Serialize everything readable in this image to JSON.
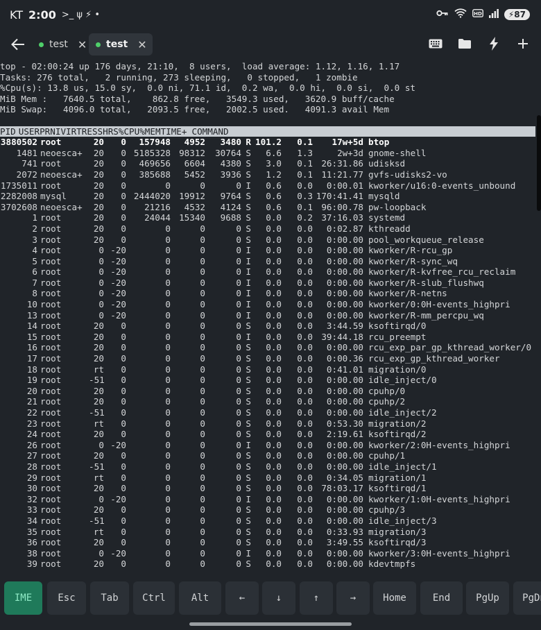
{
  "status_bar": {
    "carrier": "KT",
    "time": "2:00",
    "symbols": ">_  ψ  ⚡  •",
    "battery": "87"
  },
  "tabs": [
    {
      "label": "test",
      "active": false
    },
    {
      "label": "test",
      "active": true
    }
  ],
  "colors": {
    "background": "#202429",
    "tab_dot": "#4fcf6a",
    "ime_key": "#1f7a5a",
    "header_bg": "#c8cdd2"
  },
  "top_summary": [
    "top - 02:00:24 up 176 days, 21:10,  8 users,  load average: 1.12, 1.16, 1.17",
    "Tasks: 276 total,   2 running, 273 sleeping,   0 stopped,   1 zombie",
    "%Cpu(s): 13.8 us, 15.0 sy,  0.0 ni, 71.1 id,  0.2 wa,  0.0 hi,  0.0 si,  0.0 st",
    "MiB Mem :   7640.5 total,    862.8 free,   3549.3 used,   3620.9 buff/cache",
    "MiB Swap:   4096.0 total,   2093.5 free,   2002.5 used.   4091.3 avail Mem"
  ],
  "columns": [
    "PID",
    "USER",
    "PR",
    "NI",
    "VIRT",
    "RES",
    "SHR",
    "S",
    "%CPU",
    "%MEM",
    "TIME+",
    "COMMAND"
  ],
  "processes": [
    [
      "3880502",
      "root",
      "20",
      "0",
      "157948",
      "4952",
      "3480",
      "R",
      "101.2",
      "0.1",
      "17w+5d",
      "btop"
    ],
    [
      "1481",
      "neoesca+",
      "20",
      "0",
      "5185328",
      "98312",
      "30764",
      "S",
      "6.6",
      "1.3",
      "2w+3d",
      "gnome-shell"
    ],
    [
      "741",
      "root",
      "20",
      "0",
      "469656",
      "6604",
      "4380",
      "S",
      "3.0",
      "0.1",
      "26:31.86",
      "udisksd"
    ],
    [
      "2072",
      "neoesca+",
      "20",
      "0",
      "385688",
      "5452",
      "3936",
      "S",
      "1.2",
      "0.1",
      "11:21.77",
      "gvfs-udisks2-vo"
    ],
    [
      "1735011",
      "root",
      "20",
      "0",
      "0",
      "0",
      "0",
      "I",
      "0.6",
      "0.0",
      "0:00.01",
      "kworker/u16:0-events_unbound"
    ],
    [
      "2282008",
      "mysql",
      "20",
      "0",
      "2444020",
      "19912",
      "9764",
      "S",
      "0.6",
      "0.3",
      "170:41.41",
      "mysqld"
    ],
    [
      "3702608",
      "neoesca+",
      "20",
      "0",
      "21216",
      "4532",
      "4124",
      "S",
      "0.6",
      "0.1",
      "96:00.78",
      "pw-loopback"
    ],
    [
      "1",
      "root",
      "20",
      "0",
      "24044",
      "15340",
      "9688",
      "S",
      "0.0",
      "0.2",
      "37:16.03",
      "systemd"
    ],
    [
      "2",
      "root",
      "20",
      "0",
      "0",
      "0",
      "0",
      "S",
      "0.0",
      "0.0",
      "0:02.87",
      "kthreadd"
    ],
    [
      "3",
      "root",
      "20",
      "0",
      "0",
      "0",
      "0",
      "S",
      "0.0",
      "0.0",
      "0:00.00",
      "pool_workqueue_release"
    ],
    [
      "4",
      "root",
      "0",
      "-20",
      "0",
      "0",
      "0",
      "I",
      "0.0",
      "0.0",
      "0:00.00",
      "kworker/R-rcu_gp"
    ],
    [
      "5",
      "root",
      "0",
      "-20",
      "0",
      "0",
      "0",
      "I",
      "0.0",
      "0.0",
      "0:00.00",
      "kworker/R-sync_wq"
    ],
    [
      "6",
      "root",
      "0",
      "-20",
      "0",
      "0",
      "0",
      "I",
      "0.0",
      "0.0",
      "0:00.00",
      "kworker/R-kvfree_rcu_reclaim"
    ],
    [
      "7",
      "root",
      "0",
      "-20",
      "0",
      "0",
      "0",
      "I",
      "0.0",
      "0.0",
      "0:00.00",
      "kworker/R-slub_flushwq"
    ],
    [
      "8",
      "root",
      "0",
      "-20",
      "0",
      "0",
      "0",
      "I",
      "0.0",
      "0.0",
      "0:00.00",
      "kworker/R-netns"
    ],
    [
      "10",
      "root",
      "0",
      "-20",
      "0",
      "0",
      "0",
      "I",
      "0.0",
      "0.0",
      "0:00.00",
      "kworker/0:0H-events_highpri"
    ],
    [
      "13",
      "root",
      "0",
      "-20",
      "0",
      "0",
      "0",
      "I",
      "0.0",
      "0.0",
      "0:00.00",
      "kworker/R-mm_percpu_wq"
    ],
    [
      "14",
      "root",
      "20",
      "0",
      "0",
      "0",
      "0",
      "S",
      "0.0",
      "0.0",
      "3:44.59",
      "ksoftirqd/0"
    ],
    [
      "15",
      "root",
      "20",
      "0",
      "0",
      "0",
      "0",
      "I",
      "0.0",
      "0.0",
      "39:44.18",
      "rcu_preempt"
    ],
    [
      "16",
      "root",
      "20",
      "0",
      "0",
      "0",
      "0",
      "S",
      "0.0",
      "0.0",
      "0:00.00",
      "rcu_exp_par_gp_kthread_worker/0"
    ],
    [
      "17",
      "root",
      "20",
      "0",
      "0",
      "0",
      "0",
      "S",
      "0.0",
      "0.0",
      "0:00.36",
      "rcu_exp_gp_kthread_worker"
    ],
    [
      "18",
      "root",
      "rt",
      "0",
      "0",
      "0",
      "0",
      "S",
      "0.0",
      "0.0",
      "0:41.01",
      "migration/0"
    ],
    [
      "19",
      "root",
      "-51",
      "0",
      "0",
      "0",
      "0",
      "S",
      "0.0",
      "0.0",
      "0:00.00",
      "idle_inject/0"
    ],
    [
      "20",
      "root",
      "20",
      "0",
      "0",
      "0",
      "0",
      "S",
      "0.0",
      "0.0",
      "0:00.00",
      "cpuhp/0"
    ],
    [
      "21",
      "root",
      "20",
      "0",
      "0",
      "0",
      "0",
      "S",
      "0.0",
      "0.0",
      "0:00.00",
      "cpuhp/2"
    ],
    [
      "22",
      "root",
      "-51",
      "0",
      "0",
      "0",
      "0",
      "S",
      "0.0",
      "0.0",
      "0:00.00",
      "idle_inject/2"
    ],
    [
      "23",
      "root",
      "rt",
      "0",
      "0",
      "0",
      "0",
      "S",
      "0.0",
      "0.0",
      "0:53.30",
      "migration/2"
    ],
    [
      "24",
      "root",
      "20",
      "0",
      "0",
      "0",
      "0",
      "S",
      "0.0",
      "0.0",
      "2:19.61",
      "ksoftirqd/2"
    ],
    [
      "26",
      "root",
      "0",
      "-20",
      "0",
      "0",
      "0",
      "I",
      "0.0",
      "0.0",
      "0:00.00",
      "kworker/2:0H-events_highpri"
    ],
    [
      "27",
      "root",
      "20",
      "0",
      "0",
      "0",
      "0",
      "S",
      "0.0",
      "0.0",
      "0:00.00",
      "cpuhp/1"
    ],
    [
      "28",
      "root",
      "-51",
      "0",
      "0",
      "0",
      "0",
      "S",
      "0.0",
      "0.0",
      "0:00.00",
      "idle_inject/1"
    ],
    [
      "29",
      "root",
      "rt",
      "0",
      "0",
      "0",
      "0",
      "S",
      "0.0",
      "0.0",
      "0:34.05",
      "migration/1"
    ],
    [
      "30",
      "root",
      "20",
      "0",
      "0",
      "0",
      "0",
      "S",
      "0.0",
      "0.0",
      "78:03.17",
      "ksoftirqd/1"
    ],
    [
      "32",
      "root",
      "0",
      "-20",
      "0",
      "0",
      "0",
      "I",
      "0.0",
      "0.0",
      "0:00.00",
      "kworker/1:0H-events_highpri"
    ],
    [
      "33",
      "root",
      "20",
      "0",
      "0",
      "0",
      "0",
      "S",
      "0.0",
      "0.0",
      "0:00.00",
      "cpuhp/3"
    ],
    [
      "34",
      "root",
      "-51",
      "0",
      "0",
      "0",
      "0",
      "S",
      "0.0",
      "0.0",
      "0:00.00",
      "idle_inject/3"
    ],
    [
      "35",
      "root",
      "rt",
      "0",
      "0",
      "0",
      "0",
      "S",
      "0.0",
      "0.0",
      "0:33.93",
      "migration/3"
    ],
    [
      "36",
      "root",
      "20",
      "0",
      "0",
      "0",
      "0",
      "S",
      "0.0",
      "0.0",
      "3:49.55",
      "ksoftirqd/3"
    ],
    [
      "38",
      "root",
      "0",
      "-20",
      "0",
      "0",
      "0",
      "I",
      "0.0",
      "0.0",
      "0:00.00",
      "kworker/3:0H-events_highpri"
    ],
    [
      "39",
      "root",
      "20",
      "0",
      "0",
      "0",
      "0",
      "S",
      "0.0",
      "0.0",
      "0:00.00",
      "kdevtmpfs"
    ]
  ],
  "extra_keys": [
    "IME",
    "Esc",
    "Tab",
    "Ctrl",
    "Alt",
    "←",
    "↓",
    "↑",
    "→",
    "Home",
    "End",
    "PgUp",
    "PgDn"
  ]
}
